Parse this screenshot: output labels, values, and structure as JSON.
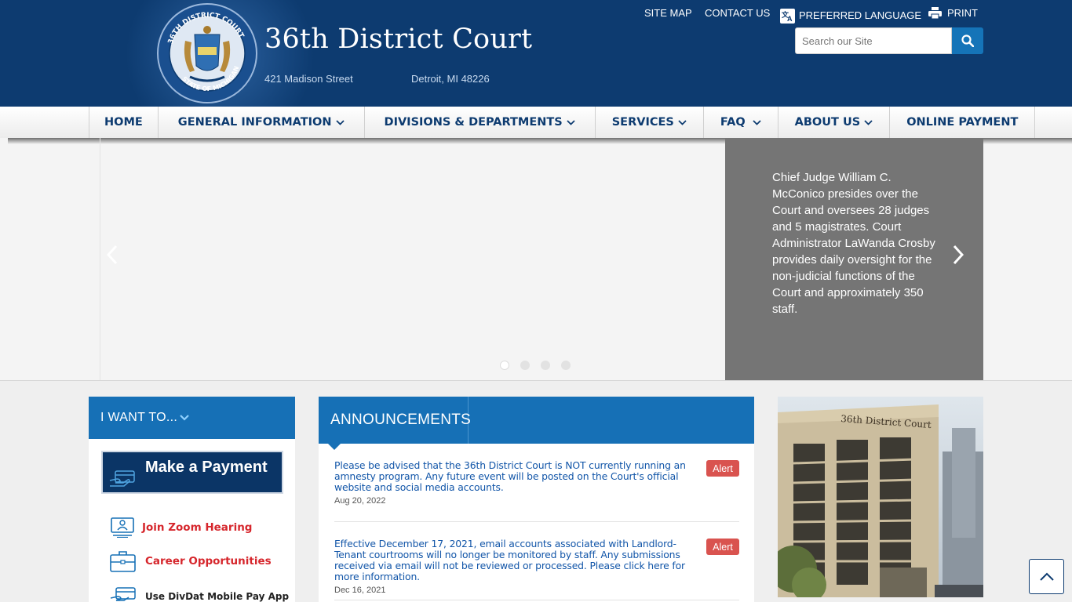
{
  "site": {
    "title": "36th District Court",
    "street": "421 Madison Street",
    "city": "Detroit, MI 48226"
  },
  "utility": {
    "site_map": "SITE MAP",
    "contact_us": "CONTACT US",
    "preferred_language": "PREFERRED LANGUAGE",
    "print": "PRINT"
  },
  "search": {
    "placeholder": "Search our Site",
    "value": ""
  },
  "nav": {
    "items": [
      {
        "label": "HOME",
        "dropdown": false
      },
      {
        "label": "GENERAL INFORMATION",
        "dropdown": true
      },
      {
        "label": "DIVISIONS & DEPARTMENTS",
        "dropdown": true
      },
      {
        "label": "SERVICES",
        "dropdown": true
      },
      {
        "label": "FAQ",
        "dropdown": true
      },
      {
        "label": "ABOUT US",
        "dropdown": true
      },
      {
        "label": "ONLINE PAYMENT",
        "dropdown": false
      }
    ]
  },
  "slider": {
    "caption": "Chief Judge William C. McConico presides over the Court and oversees 28 judges and 5 magistrates. Court Administrator LaWanda Crosby provides daily oversight for the non-judicial functions of the Court and approximately 350 staff.",
    "slide_count": 4,
    "active_slide": 1
  },
  "i_want_to": {
    "title": "I WANT TO...",
    "payment_button": "Make a Payment",
    "links": [
      {
        "label": "Join Zoom Hearing",
        "icon": "video-meeting-icon"
      },
      {
        "label": "Career Opportunities",
        "icon": "briefcase-icon"
      },
      {
        "label": "Use DivDat Mobile Pay App",
        "icon": "mobile-pay-icon"
      }
    ]
  },
  "announcements": {
    "title": "ANNOUNCEMENTS",
    "items": [
      {
        "text": "Please be advised that the 36th District Court is NOT currently running an amnesty program. Any future event will be posted on the Court's official website and social media accounts.",
        "badge": "Alert",
        "date": "Aug 20, 2022"
      },
      {
        "text": "Effective December 17, 2021, email accounts associated with Landlord-Tenant courtrooms will no longer be monitored by staff. Any submissions received via email will not be reviewed or processed. Please click here for more information.",
        "badge": "Alert",
        "date": "Dec 16, 2021"
      }
    ]
  },
  "building_sign": "36th District Court",
  "colors": {
    "header_bg": "#0d3b70",
    "accent_blue": "#1670b6",
    "alert_red": "#d9534f",
    "link_red": "#d6262c"
  }
}
